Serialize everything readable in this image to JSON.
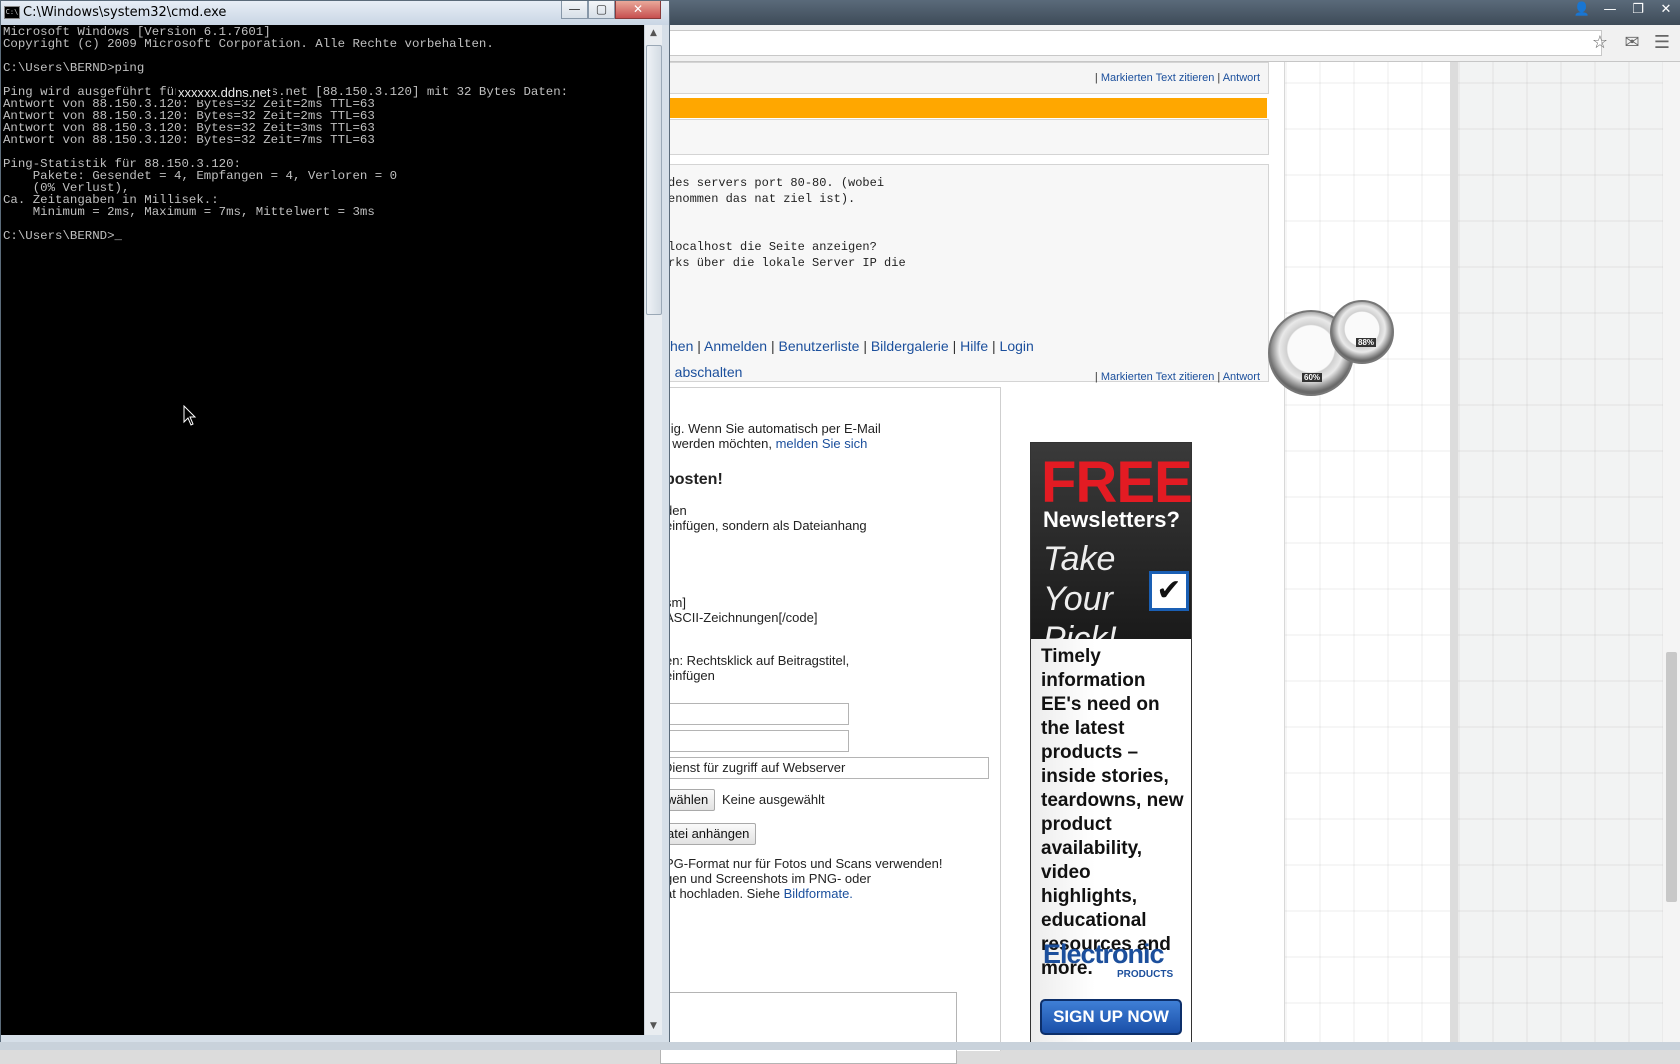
{
  "cmd": {
    "title": "C:\\Windows\\system32\\cmd.exe",
    "buttons": {
      "minimize": "—",
      "maximize": "▢",
      "close": "✕"
    },
    "lines": [
      "Microsoft Windows [Version 6.1.7601]",
      "Copyright (c) 2009 Microsoft Corporation. Alle Rechte vorbehalten.",
      "",
      "C:\\Users\\BERND>ping",
      "",
      "Ping wird ausgeführt für homestm.ddns.net [88.150.3.120] mit 32 Bytes Daten:",
      "Antwort von 88.150.3.120: Bytes=32 Zeit=2ms TTL=63",
      "Antwort von 88.150.3.120: Bytes=32 Zeit=2ms TTL=63",
      "Antwort von 88.150.3.120: Bytes=32 Zeit=3ms TTL=63",
      "Antwort von 88.150.3.120: Bytes=32 Zeit=7ms TTL=63",
      "",
      "Ping-Statistik für 88.150.3.120:",
      "    Pakete: Gesendet = 4, Empfangen = 4, Verloren = 0",
      "    (0% Verlust),",
      "Ca. Zeitangaben in Millisek.:",
      "    Minimum = 2ms, Maximum = 7ms, Mittelwert = 3ms",
      "",
      "C:\\Users\\BERND>_"
    ],
    "overlay_host": "xxxxxx.ddns.net"
  },
  "browser": {
    "window_controls": {
      "user": "👤",
      "minimize": "—",
      "restore": "❐",
      "close": "✕"
    },
    "toolbar": {
      "star_icon": "☆",
      "gmail_icon": "✉",
      "menu_icon": "☰"
    },
    "post1": {
      "quote_link": "Markierten Text zitieren",
      "answer_link": "Antwort",
      "sep": "|"
    },
    "post2": {
      "code_lines": [
        "des servers port 80-80. (wobei",
        "enommen das nat ziel ist).",
        "",
        "",
        "localhost die Seite anzeigen?",
        "rks über die lokale Server IP die"
      ],
      "quote_link": "Markierten Text zitieren",
      "answer_link": "Antwort",
      "sep": "|"
    },
    "nav": {
      "items": [
        "chen",
        "Anmelden",
        "Benutzerliste",
        "Bildergalerie",
        "Hilfe",
        "Login"
      ],
      "sep": "|",
      "second_line": "g abschalten"
    },
    "form": {
      "notify_text_1": "llig. Wenn Sie automatisch per E-Mail",
      "notify_text_2": "t werden möchten,",
      "notify_link": "melden Sie sich",
      "heading": "posten!",
      "rule_1": "den",
      "rule_2": "einfügen, sondern als Dateianhang",
      "code_1": "sm]",
      "code_2": "ASCII-Zeichnungen[/code]",
      "code_3": "]",
      "hint_1": "en: Rechtsklick auf Beitragstitel,",
      "hint_2": "einfügen",
      "subject_value": "Dienst für zugriff auf Webserver",
      "choose_button": "wählen",
      "no_file": "Keine ausgewählt",
      "attach_button": "atei anhängen",
      "img_hint_1": "PG-Format nur für Fotos und Scans verwenden!",
      "img_hint_2": "gen und Screenshots im PNG- oder",
      "img_hint_3": "at hochladen. Siehe",
      "img_hint_link": "Bildformate."
    },
    "ad": {
      "free": "FREE",
      "newsletters": "Newsletters?",
      "take": "Take Your Pick!",
      "check": "✔",
      "body": "Timely information EE's need on the latest products – inside stories, teardowns, new product availability, video highlights, educational resources and more.",
      "brand": "Electronic",
      "brand_sub": "PRODUCTS",
      "signup": "SIGN UP NOW"
    },
    "gadget": {
      "cpu_value": "60%",
      "mem_value": "88%"
    }
  }
}
